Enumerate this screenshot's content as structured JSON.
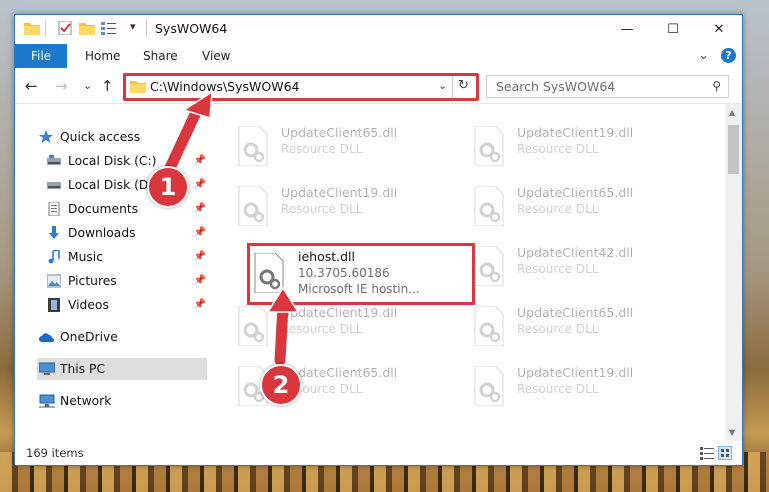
{
  "window": {
    "title": "SysWOW64",
    "minimize_glyph": "—",
    "maximize_glyph": "☐",
    "close_glyph": "✕"
  },
  "ribbon": {
    "tabs": [
      "File",
      "Home",
      "Share",
      "View"
    ],
    "expand_glyph": "⌄",
    "help_glyph": "?"
  },
  "navigation": {
    "back_glyph": "←",
    "forward_glyph": "→",
    "recent_glyph": "⌄",
    "up_glyph": "↑"
  },
  "address_bar": {
    "path": "C:\\Windows\\SysWOW64",
    "dropdown_glyph": "⌄",
    "refresh_glyph": "↻"
  },
  "search": {
    "placeholder": "Search SysWOW64"
  },
  "sidebar": {
    "items": [
      {
        "label": "Quick access",
        "icon": "star-icon"
      },
      {
        "label": "Local Disk (C:)",
        "icon": "drive-icon",
        "pinned": true
      },
      {
        "label": "Local Disk (D:)",
        "icon": "drive-icon",
        "pinned": true
      },
      {
        "label": "Documents",
        "icon": "documents-icon",
        "pinned": true
      },
      {
        "label": "Downloads",
        "icon": "downloads-icon",
        "pinned": true
      },
      {
        "label": "Music",
        "icon": "music-icon",
        "pinned": true
      },
      {
        "label": "Pictures",
        "icon": "pictures-icon",
        "pinned": true
      },
      {
        "label": "Videos",
        "icon": "videos-icon",
        "pinned": true
      },
      {
        "label": "OneDrive",
        "icon": "cloud-icon"
      },
      {
        "label": "This PC",
        "icon": "computer-icon",
        "selected": true
      },
      {
        "label": "Network",
        "icon": "network-icon"
      }
    ]
  },
  "files": [
    {
      "name": "UpdateClient65.dll",
      "type": "Resource DLL"
    },
    {
      "name": "UpdateClient19.dll",
      "type": "Resource DLL"
    },
    {
      "name": "UpdateClient19.dll",
      "type": "Resource DLL"
    },
    {
      "name": "UpdateClient65.dll",
      "type": "Resource DLL"
    },
    {
      "name": "iehost.dll",
      "version": "10.3705.60186",
      "description": "Microsoft IE hostin..."
    },
    {
      "name": "UpdateClient42.dll",
      "type": "Resource DLL"
    },
    {
      "name": "UpdateClient19.dll",
      "type": "Resource DLL"
    },
    {
      "name": "UpdateClient65.dll",
      "type": "Resource DLL"
    },
    {
      "name": "UpdateClient65.dll",
      "type": "Resource DLL"
    },
    {
      "name": "UpdateClient19.dll",
      "type": "Resource DLL"
    }
  ],
  "status": {
    "item_count": "169 items"
  },
  "callouts": [
    "1",
    "2"
  ],
  "colors": {
    "accent": "#1979ca",
    "callout": "#d9363e",
    "selected": "#cce8ff"
  }
}
